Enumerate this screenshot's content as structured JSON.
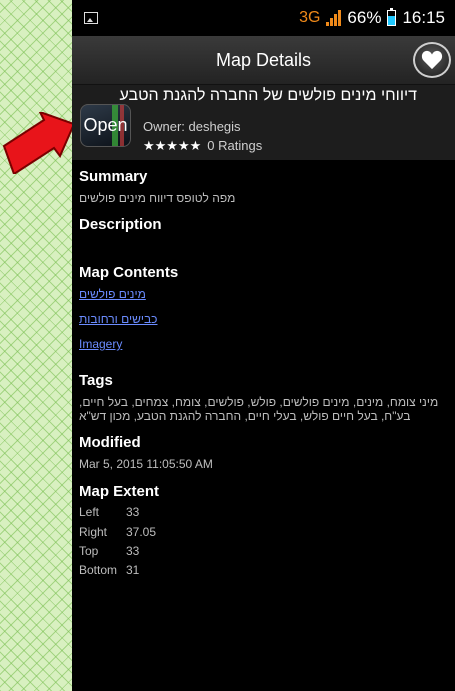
{
  "status": {
    "network": "3G",
    "battery_percent": "66%",
    "battery_level": 0.66,
    "time": "16:15"
  },
  "titlebar": {
    "title": "Map Details"
  },
  "map": {
    "title": "דיווחי מינים פולשים של החברה להגנת הטבע",
    "open_label": "Open",
    "owner": "Owner: deshegis",
    "stars": "★★★★★",
    "ratings": "0 Ratings"
  },
  "summary": {
    "heading": "Summary",
    "text": "מפה לטופס דיווח מינים פולשים"
  },
  "description": {
    "heading": "Description"
  },
  "contents": {
    "heading": "Map Contents",
    "items": [
      "מינים פולשים",
      "כבישים ורחובות",
      "Imagery"
    ]
  },
  "tags": {
    "heading": "Tags",
    "line1": "מיני צומח, מינים, מינים פולשים, פולש, פולשים, צומח, צמחים, בעל חיים,",
    "line2": "בע\"ח, בעל חיים פולש, בעלי חיים, החברה להגנת הטבע, מכון דש\"א"
  },
  "modified": {
    "heading": "Modified",
    "value": "Mar 5, 2015 11:05:50 AM"
  },
  "extent": {
    "heading": "Map Extent",
    "rows": [
      {
        "label": "Left",
        "value": "33"
      },
      {
        "label": "Right",
        "value": "37.05"
      },
      {
        "label": "Top",
        "value": "33"
      },
      {
        "label": "Bottom",
        "value": "31"
      }
    ]
  },
  "colors": {
    "accent_orange": "#f08a1a",
    "link": "#6b8cff",
    "arrow": "#e8141a",
    "battery": "#1ec8ff"
  }
}
